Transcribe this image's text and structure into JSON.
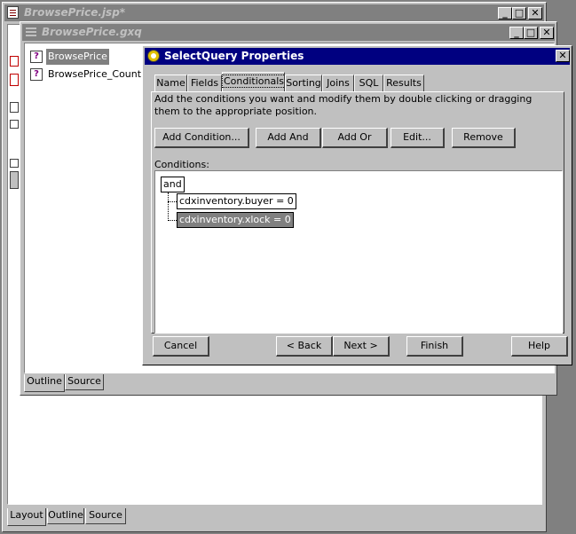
{
  "jsp_window": {
    "title": "BrowsePrice.jsp*",
    "bottom_tabs": [
      "Layout",
      "Outline",
      "Source"
    ]
  },
  "gxq_window": {
    "title": "BrowsePrice.gxq",
    "tree_items": [
      "BrowsePrice",
      "BrowsePrice_Count"
    ],
    "bottom_tabs": [
      "Outline",
      "Source"
    ]
  },
  "dialog": {
    "title": "SelectQuery Properties",
    "tabs": [
      "Name",
      "Fields",
      "Conditionals",
      "Sorting",
      "Joins",
      "SQL",
      "Results"
    ],
    "active_tab": "Conditionals",
    "instructions": "Add the conditions you want and modify them by double clicking or dragging them to the appropriate position.",
    "action_buttons": {
      "add_condition": "Add Condition...",
      "add_and": "Add And",
      "add_or": "Add Or",
      "edit": "Edit...",
      "remove": "Remove"
    },
    "conditions_label": "Conditions:",
    "condition_root": "and",
    "conditions": [
      "cdxinventory.buyer = 0",
      "cdxinventory.xlock = 0"
    ],
    "footer_buttons": {
      "cancel": "Cancel",
      "back": "< Back",
      "next": "Next >",
      "finish": "Finish",
      "help": "Help"
    }
  },
  "colors": {
    "active_title": "#000080",
    "inactive_title": "#808080",
    "face": "#c0c0c0",
    "selection": "#808080"
  }
}
